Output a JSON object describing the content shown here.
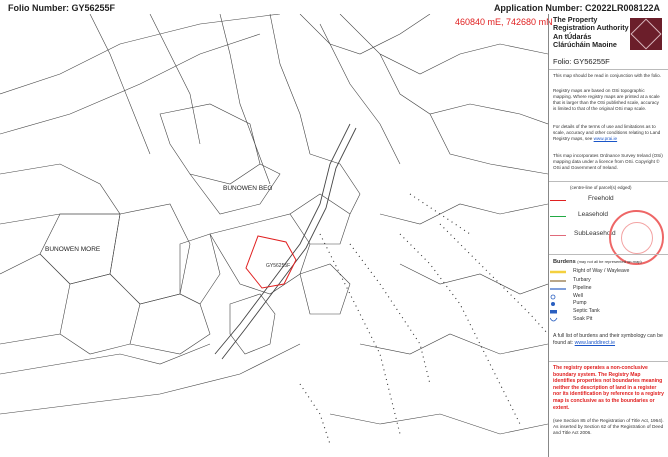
{
  "header": {
    "folio_number": "Folio Number: GY56255F",
    "application_number": "Application Number: C2022LR008122A",
    "coordinates": "460840 mE, 742680 mN"
  },
  "map": {
    "places": [
      "BUNOWEN BEG",
      "BUNOWEN MORE"
    ],
    "plot_label": "GY56255F",
    "plot_color": "#e02020"
  },
  "authority": {
    "title_en_1": "The Property",
    "title_en_2": "Registration Authority",
    "title_ga_1": "An tÚdarás",
    "title_ga_2": "Clárúcháin Maoine",
    "folio": "Folio:   GY56255F"
  },
  "notes": {
    "read_with": "This map should be read in conjunction with the folio.",
    "osi": "Registry maps are based on OSi topographic mapping. Where registry maps are printed at a scale that is larger than the OSi published scale, accuracy is limited to that of the original OSi map scale.",
    "details": "For details of the terms of use and limitations as to scale, accuracy and other conditions relating to Land Registry maps, see",
    "details_link": "www.prai.ie",
    "copyright": "This map incorporates Ordnance Survey Ireland (OSi) mapping data under a licence from OSi. Copyright © OSi and Government of Ireland."
  },
  "legend": {
    "note": "(centre-line of parcel(s) edged)",
    "items": [
      {
        "label": "Freehold",
        "color": "#e02020"
      },
      {
        "label": "Leasehold",
        "color": "#22aa44"
      },
      {
        "label": "SubLeasehold",
        "color": "#e06a7a"
      }
    ]
  },
  "burdens": {
    "title": "Burdens",
    "note": "(may not all be represented on map)",
    "items": [
      {
        "label": "Right of Way / Wayleave",
        "icon": "yellow-line-icon"
      },
      {
        "label": "Turbary",
        "icon": "brown-line-icon"
      },
      {
        "label": "Pipeline",
        "icon": "blue-line-icon"
      },
      {
        "label": "Well",
        "icon": "circle-icon"
      },
      {
        "label": "Pump",
        "icon": "dot-icon"
      },
      {
        "label": "Septic Tank",
        "icon": "tank-icon"
      },
      {
        "label": "Soak Pit",
        "icon": "soakpit-icon"
      }
    ],
    "full_list": "A full list of burdens and their symbology can be found at:",
    "full_list_link": "www.landdirect.ie"
  },
  "disclaimer": {
    "text": "The registry operates a non-conclusive boundary system. The Registry Map identifies properties not boundaries meaning neither the description of land in a register nor its identification by reference to a registry map is conclusive as to the boundaries or extent.",
    "tail": "(see Section 85 of the Registration of Title Act, 1964). As inserted by Section 62 of the Registration of Deed and Title Act 2006."
  }
}
